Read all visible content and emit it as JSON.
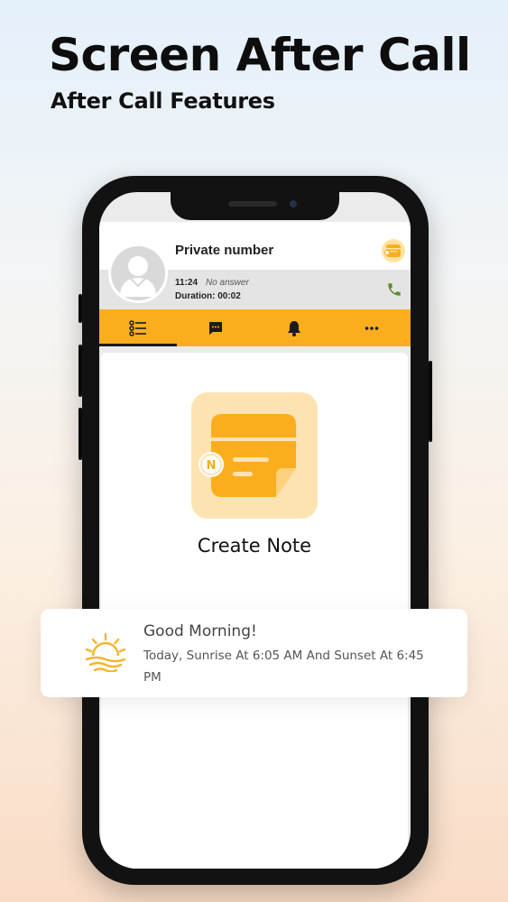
{
  "promo": {
    "title": "Screen After Call",
    "subtitle": "After Call Features"
  },
  "call": {
    "caller": "Private number",
    "time": "11:24",
    "status": "No answer",
    "duration": "Duration: 00:02"
  },
  "tabs": [
    {
      "icon": "list-icon",
      "active": true
    },
    {
      "icon": "chat-icon",
      "active": false
    },
    {
      "icon": "bell-icon",
      "active": false
    },
    {
      "icon": "more-icon",
      "active": false
    }
  ],
  "note": {
    "badge_letter": "N",
    "label": "Create Note"
  },
  "weather": {
    "greeting": "Good Morning!",
    "detail": "Today, Sunrise At 6:05 AM And Sunset At 6:45 PM"
  },
  "colors": {
    "accent": "#fbae1d",
    "note_tile": "#fee3b2",
    "note_icon": "#fbae1d",
    "call_icon": "#5a8f2e"
  }
}
